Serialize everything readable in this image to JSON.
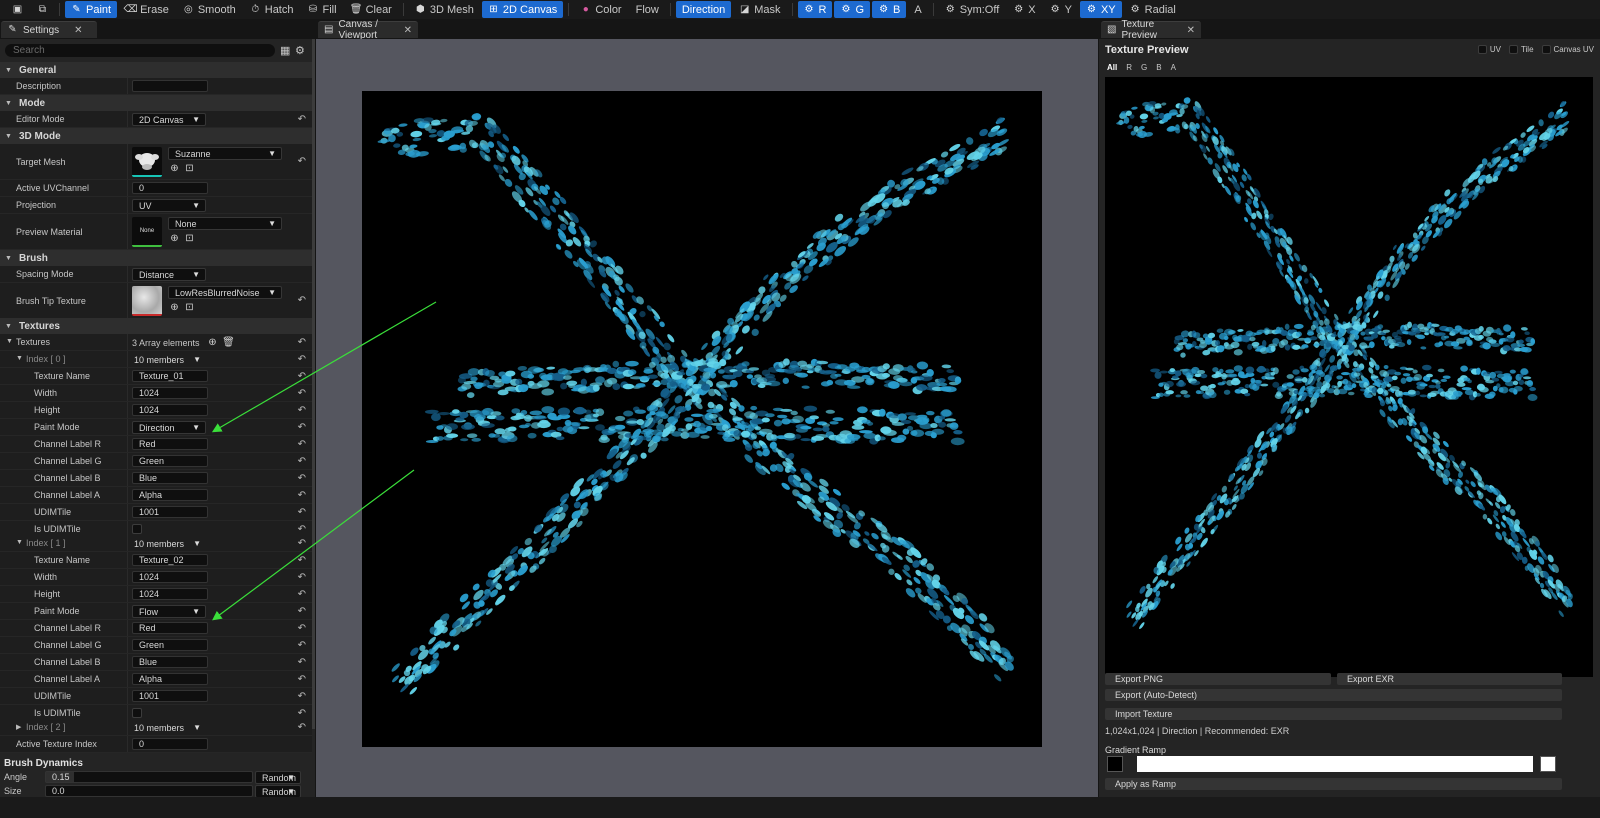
{
  "toolbar": {
    "items": [
      {
        "label": "Paint",
        "icon": "paint-icon",
        "active": true
      },
      {
        "label": "Erase",
        "icon": "erase-icon",
        "active": false
      },
      {
        "label": "Smooth",
        "icon": "smooth-icon",
        "active": false
      },
      {
        "label": "Hatch",
        "icon": "hatch-icon",
        "active": false
      },
      {
        "label": "Fill",
        "icon": "fill-icon",
        "active": false
      },
      {
        "label": "Clear",
        "icon": "clear-icon",
        "active": false
      },
      {
        "label": "3D Mesh",
        "icon": "mesh-icon",
        "active": false
      },
      {
        "label": "2D Canvas",
        "icon": "canvas-icon",
        "active": true
      },
      {
        "label": "Color",
        "icon": "color-wheel-icon",
        "active": false
      },
      {
        "label": "Flow",
        "icon": "",
        "active": false
      },
      {
        "label": "Direction",
        "icon": "",
        "active": true
      },
      {
        "label": "Mask",
        "icon": "mask-icon",
        "active": false
      },
      {
        "label": "R",
        "icon": "channel-icon",
        "active": true
      },
      {
        "label": "G",
        "icon": "channel-icon",
        "active": true
      },
      {
        "label": "B",
        "icon": "channel-icon",
        "active": true
      },
      {
        "label": "A",
        "icon": "",
        "active": false
      },
      {
        "label": "Sym:Off",
        "icon": "symmetry-icon",
        "active": false
      },
      {
        "label": "X",
        "icon": "axis-icon",
        "active": false
      },
      {
        "label": "Y",
        "icon": "axis-icon",
        "active": false
      },
      {
        "label": "XY",
        "icon": "axis-icon",
        "active": true
      },
      {
        "label": "Radial",
        "icon": "radial-icon",
        "active": false
      }
    ],
    "accent_color": "#1d6ad0"
  },
  "tabs": {
    "settings": "Settings",
    "canvas": "Canvas / Viewport",
    "preview": "Texture Preview"
  },
  "settings": {
    "search_placeholder": "Search",
    "sections": {
      "general": "General",
      "mode": "Mode",
      "mode3d": "3D Mode",
      "brush": "Brush",
      "textures": "Textures",
      "dynamics": "Brush Dynamics"
    },
    "description_label": "Description",
    "description_value": "",
    "editor_mode_label": "Editor Mode",
    "editor_mode_value": "2D Canvas",
    "target_mesh_label": "Target Mesh",
    "target_mesh_value": "Suzanne",
    "active_uv_label": "Active UVChannel",
    "active_uv_value": "0",
    "projection_label": "Projection",
    "projection_value": "UV",
    "preview_material_label": "Preview Material",
    "preview_material_value": "None",
    "preview_material_thumb": "None",
    "spacing_mode_label": "Spacing Mode",
    "spacing_mode_value": "Distance",
    "brush_tip_label": "Brush Tip Texture",
    "brush_tip_value": "LowResBlurredNoise",
    "textures_label": "Textures",
    "textures_count": "3 Array elements",
    "index0": {
      "label": "Index [ 0 ]",
      "members": "10 members"
    },
    "index1": {
      "label": "Index [ 1 ]",
      "members": "10 members"
    },
    "index2": {
      "label": "Index [ 2 ]",
      "members": "10 members"
    },
    "fields": {
      "texture_name": "Texture Name",
      "width": "Width",
      "height": "Height",
      "paint_mode": "Paint Mode",
      "ch_r": "Channel Label R",
      "ch_g": "Channel Label G",
      "ch_b": "Channel Label B",
      "ch_a": "Channel Label A",
      "udim": "UDIMTile",
      "is_udim": "Is UDIMTile"
    },
    "tex0": {
      "name": "Texture_01",
      "width": "1024",
      "height": "1024",
      "paint_mode": "Direction",
      "r": "Red",
      "g": "Green",
      "b": "Blue",
      "a": "Alpha",
      "udim": "1001"
    },
    "tex1": {
      "name": "Texture_02",
      "width": "1024",
      "height": "1024",
      "paint_mode": "Flow",
      "r": "Red",
      "g": "Green",
      "b": "Blue",
      "a": "Alpha",
      "udim": "1001"
    },
    "active_tex_label": "Active Texture Index",
    "active_tex_value": "0",
    "angle_label": "Angle",
    "angle_value": "0.15",
    "angle_mode": "Random",
    "size_label": "Size",
    "size_value": "0.0",
    "size_mode": "Random"
  },
  "preview": {
    "title": "Texture Preview",
    "toggles": [
      "UV",
      "Tile",
      "Canvas UV"
    ],
    "channels": [
      "All",
      "R",
      "G",
      "B",
      "A"
    ],
    "export_png": "Export PNG",
    "export_exr": "Export EXR",
    "export_auto": "Export (Auto-Detect)",
    "import": "Import Texture",
    "info": "1,024x1,024 | Direction | Recommended: EXR",
    "gradient_label": "Gradient Ramp",
    "apply": "Apply as Ramp"
  },
  "colors": {
    "stroke_light": "#63d4ea",
    "stroke_mid": "#2a9fd0",
    "stroke_dark": "#155f8a",
    "annotation_arrow": "#3adf3a"
  }
}
